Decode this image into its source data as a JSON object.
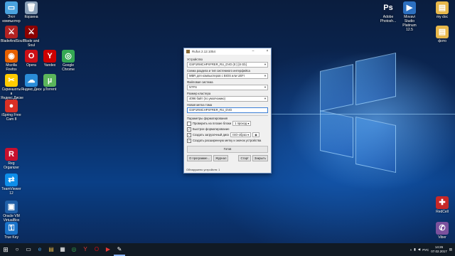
{
  "desktop": {
    "icons_left": [
      {
        "label": "Этот компьютер",
        "icon": "computer-icon",
        "color": "#4aa3df",
        "glyph": "▭"
      },
      {
        "label": "Корзина",
        "icon": "recycle-bin-icon",
        "color": "#8aa0b8",
        "glyph": "🗑"
      },
      {
        "label": "BladeAndSoul",
        "icon": "bladeandsoul-icon",
        "color": "#b22222",
        "glyph": "⚔"
      },
      {
        "label": "Blade and Soul",
        "icon": "bladeandsoul-icon",
        "color": "#8b0000",
        "glyph": "⚔"
      },
      {
        "label": "Mozilla Firefox",
        "icon": "firefox-icon",
        "color": "#e66000",
        "glyph": "◉"
      },
      {
        "label": "Opera",
        "icon": "opera-icon",
        "color": "#cc0f16",
        "glyph": "O"
      },
      {
        "label": "Yandex",
        "icon": "yandex-icon",
        "color": "#cc0000",
        "glyph": "Y"
      },
      {
        "label": "Google Chrome",
        "icon": "chrome-icon",
        "color": "#34a853",
        "glyph": "◎"
      },
      {
        "label": "Скриншоты в Яндекс.Диске",
        "icon": "yandex-screenshots-icon",
        "color": "#ffcc00",
        "glyph": "✂"
      },
      {
        "label": "Яндекс.Диск",
        "icon": "yandex-disk-icon",
        "color": "#2a8cd8",
        "glyph": "☁"
      },
      {
        "label": "µTorrent",
        "icon": "utorrent-icon",
        "color": "#5bb55b",
        "glyph": "µ"
      },
      {
        "label": "iSpring Free Cam 8",
        "icon": "ispring-icon",
        "color": "#d93025",
        "glyph": "●"
      },
      {
        "label": "Reg Organizer",
        "icon": "reg-organizer-icon",
        "color": "#c8102e",
        "glyph": "R"
      },
      {
        "label": "TeamViewer 12",
        "icon": "teamviewer-icon",
        "color": "#0e8ee9",
        "glyph": "⇄"
      },
      {
        "label": "Oracle VM VirtualBox",
        "icon": "virtualbox-icon",
        "color": "#1f5fa8",
        "glyph": "▣"
      },
      {
        "label": "True Key",
        "icon": "true-key-icon",
        "color": "#1a73c9",
        "glyph": "⚿"
      }
    ],
    "icons_right": [
      {
        "label": "Adobe Photosh...",
        "icon": "photoshop-icon",
        "color": "#0b1c3d",
        "glyph": "Ps"
      },
      {
        "label": "Movavi Studio Platinum 12.5",
        "icon": "movavi-icon",
        "color": "#2c6fbf",
        "glyph": "▶"
      },
      {
        "label": "my doc",
        "icon": "folder-icon",
        "color": "#e8b84b",
        "glyph": "▤"
      },
      {
        "label": "фото",
        "icon": "folder-icon",
        "color": "#e8b84b",
        "glyph": "▤"
      },
      {
        "label": "RedCell",
        "icon": "redcell-icon",
        "color": "#c62828",
        "glyph": "✚"
      },
      {
        "label": "Viber",
        "icon": "viber-icon",
        "color": "#7b519d",
        "glyph": "✆"
      }
    ]
  },
  "rufus": {
    "title": "Rufus 2.12.1054",
    "device_label": "Устройство",
    "device_value": "GSP1RMCHPXFRER_RU_DVD (E:) [8 Gb]",
    "scheme_label": "Схема раздела и тип системного интерфейса",
    "scheme_value": "MBR для компьютеров с BIOS или UEFI",
    "fs_label": "Файловая система",
    "fs_value": "NTFS",
    "cluster_label": "Размер кластера",
    "cluster_value": "4096 байт (по умолчанию)",
    "volume_label": "Новая метка тома",
    "volume_value": "GSP1RMCHPXFRER_RU_DVD",
    "format_options_label": "Параметры форматирования",
    "check_bad_blocks": "Проверить на плохие блоки",
    "passes_value": "1 проход",
    "quick_format": "Быстрое форматирование",
    "create_bootable": "Создать загрузочный диск",
    "iso_value": "ISO-образ",
    "extended_label": "Создать расширенную метку и значок устройства",
    "status": "Готов",
    "about_btn": "О программе...",
    "log_btn": "Журнал",
    "start_btn": "Старт",
    "close_btn": "Закрыть",
    "footer": "Обнаружено устройств: 1"
  },
  "taskbar": {
    "lang": "РУС",
    "time": "14:26",
    "date": "07.02.2017"
  }
}
